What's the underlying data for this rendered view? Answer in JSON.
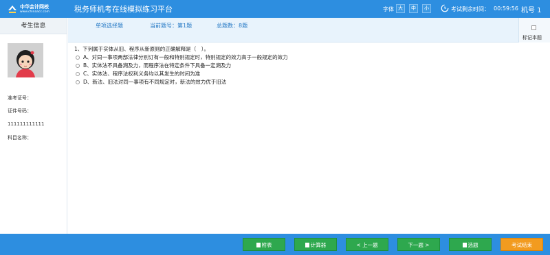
{
  "header": {
    "logo_cn": "中华会计网校",
    "logo_en": "www.chinaacc.com",
    "title": "税务师机考在线模拟练习平台",
    "font_label": "字体",
    "font_sizes": [
      "大",
      "中",
      "小"
    ],
    "timer_label": "考试剩余时间：",
    "timer_value": "00:59:56",
    "machine_label": "机号 1"
  },
  "sidebar": {
    "title": "考生信息",
    "exam_id_label": "准考证号：",
    "id_number_label": "证件号码：",
    "id_number_value": "111111111111",
    "subject_label": "科目名称："
  },
  "infobar": {
    "question_type": "单项选择题",
    "current_question": "当前题号：第1题",
    "total_questions": "总题数：8题",
    "mark_label": "标记本题"
  },
  "question": {
    "stem": "1、下列属于实体从旧、程序从新原则的正确解释是（　）。",
    "options": [
      "A、对同一事项两部法律分别订有一般和特别规定时，特别规定的效力高于一般规定的效力",
      "B、实体法不具备溯及力，而程序法在特定条件下具备一定溯及力",
      "C、实体法、程序法权利义务均以其发生的时间为准",
      "D、新法、旧法对同一事项有不同规定时，新法的效力优于旧法"
    ]
  },
  "footer": {
    "buttons": [
      "附表",
      "计算器",
      "< 上一题",
      "下一题 >",
      "选题",
      "考试结束"
    ]
  },
  "colors": {
    "primary_blue": "#2d8ee0",
    "button_green": "#2ea84e",
    "button_orange": "#f29b1f"
  }
}
